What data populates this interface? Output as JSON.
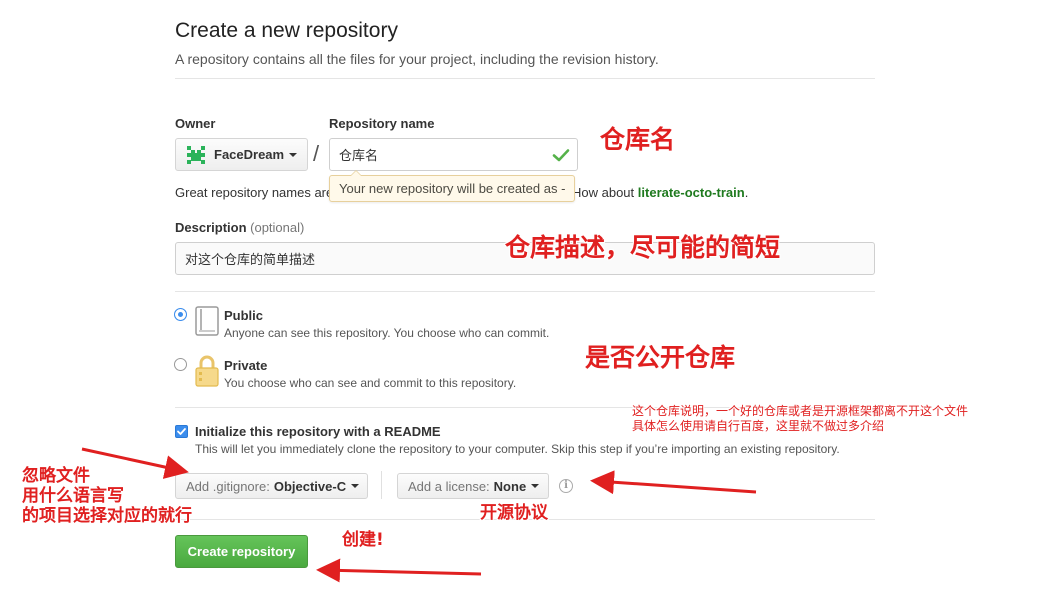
{
  "header": {
    "title": "Create a new repository",
    "subtitle": "A repository contains all the files for your project, including the revision history."
  },
  "owner": {
    "label": "Owner",
    "value": "FaceDream"
  },
  "separator": "/",
  "repo_name": {
    "label": "Repository name",
    "value": "仓库名",
    "tooltip": "Your new repository will be created as -"
  },
  "hint": {
    "prefix": "Great repository names are",
    "how_about": "How about",
    "suggestion": "literate-octo-train",
    "suffix": "."
  },
  "description": {
    "label": "Description",
    "optional": "(optional)",
    "value": "对这个仓库的简单描述"
  },
  "visibility": {
    "public": {
      "title": "Public",
      "desc": "Anyone can see this repository. You choose who can commit.",
      "selected": true
    },
    "private": {
      "title": "Private",
      "desc": "You choose who can see and commit to this repository.",
      "selected": false
    }
  },
  "readme": {
    "checked": true,
    "title": "Initialize this repository with a README",
    "desc": "This will let you immediately clone the repository to your computer. Skip this step if you’re importing an existing repository."
  },
  "gitignore": {
    "label": "Add .gitignore:",
    "value": "Objective-C"
  },
  "license": {
    "label": "Add a license:",
    "value": "None"
  },
  "create_button": "Create repository",
  "annotations": {
    "repo_name": "仓库名",
    "description": "仓库描述，尽可能的简短",
    "visibility": "是否公开仓库",
    "readme_line1": "这个仓库说明，一个好的仓库或者是开源框架都离不开这个文件",
    "readme_line2": "具体怎么使用请自行百度，这里就不做过多介绍",
    "gitignore_line1": "忽略文件",
    "gitignore_line2": "用什么语言写",
    "gitignore_line3": "的项目选择对应的就行",
    "license": "开源协议",
    "create": "创建!"
  },
  "colors": {
    "accent_blue": "#3b8ded",
    "success_green": "#55b24a",
    "annotation_red": "#e02020",
    "tooltip_bg": "#fff9ea"
  },
  "icons": {
    "owner": "identicon-avatar",
    "valid": "check-icon",
    "public": "repo-book-icon",
    "private": "lock-icon",
    "license_info": "info-icon"
  }
}
